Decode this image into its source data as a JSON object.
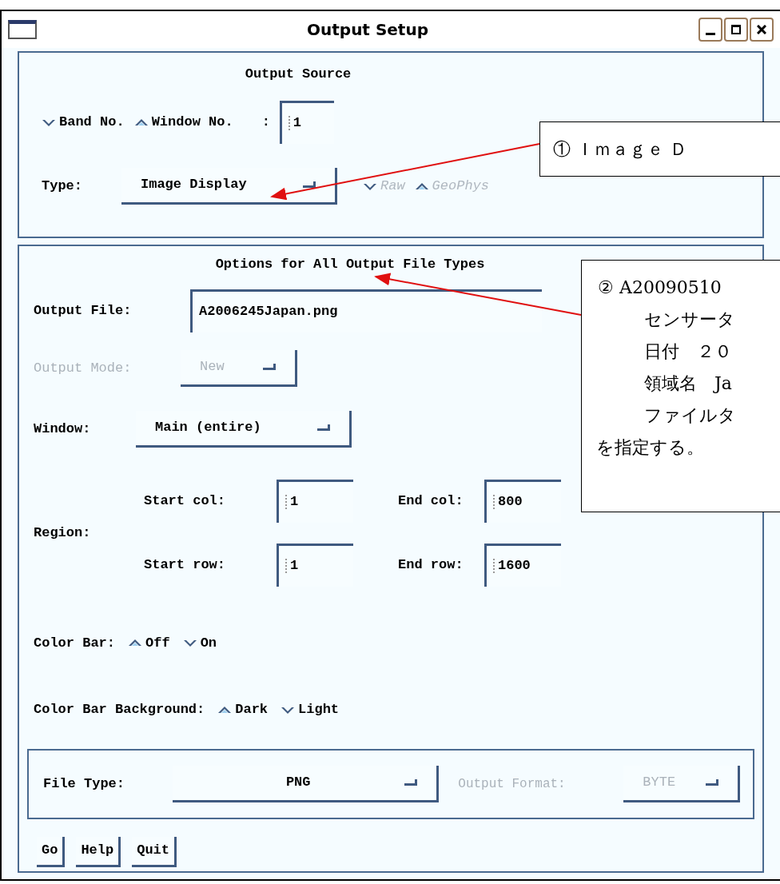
{
  "window": {
    "title": "Output Setup"
  },
  "output_source": {
    "title": "Output Source",
    "sources": [
      {
        "label": "Band No.",
        "selected": false
      },
      {
        "label": "Window No.",
        "selected": true
      }
    ],
    "colon": ":",
    "number": "1",
    "type_label": "Type:",
    "type_value": "Image Display",
    "type_options": [
      {
        "label": "Raw",
        "selected": false,
        "disabled": true
      },
      {
        "label": "GeoPhys",
        "selected": true,
        "disabled": true
      }
    ]
  },
  "options": {
    "title": "Options for All Output File Types",
    "output_file": {
      "label": "Output File:",
      "value": "A2006245Japan.png"
    },
    "output_mode": {
      "label": "Output Mode:",
      "value": "New",
      "disabled": true
    },
    "window": {
      "label": "Window:",
      "value": "Main (entire)"
    },
    "region": {
      "label": "Region:",
      "fields": [
        {
          "label": "Start col:",
          "value": "1"
        },
        {
          "label": "End col:",
          "value": "800"
        },
        {
          "label": "Start row:",
          "value": "1"
        },
        {
          "label": "End row:",
          "value": "1600"
        }
      ]
    },
    "color_bar": {
      "label": "Color Bar:",
      "options": [
        {
          "label": "Off",
          "selected": true
        },
        {
          "label": "On",
          "selected": false
        }
      ]
    },
    "color_bar_background": {
      "label": "Color Bar Background:",
      "options": [
        {
          "label": "Dark",
          "selected": true
        },
        {
          "label": "Light",
          "selected": false
        }
      ]
    },
    "file_type": {
      "label": "File Type:",
      "value": "PNG"
    },
    "output_format": {
      "label": "Output Format:",
      "value": "BYTE",
      "disabled": true
    }
  },
  "buttons": [
    "Go",
    "Help",
    "Quit"
  ],
  "callouts": [
    {
      "lines": [
        "① Ｉｍａｇｅ Ｄ"
      ]
    },
    {
      "lines": [
        "② A20090510",
        "センサータ",
        "日付　２０",
        "領域名　Ja",
        "ファイルタ",
        "を指定する。"
      ]
    }
  ]
}
